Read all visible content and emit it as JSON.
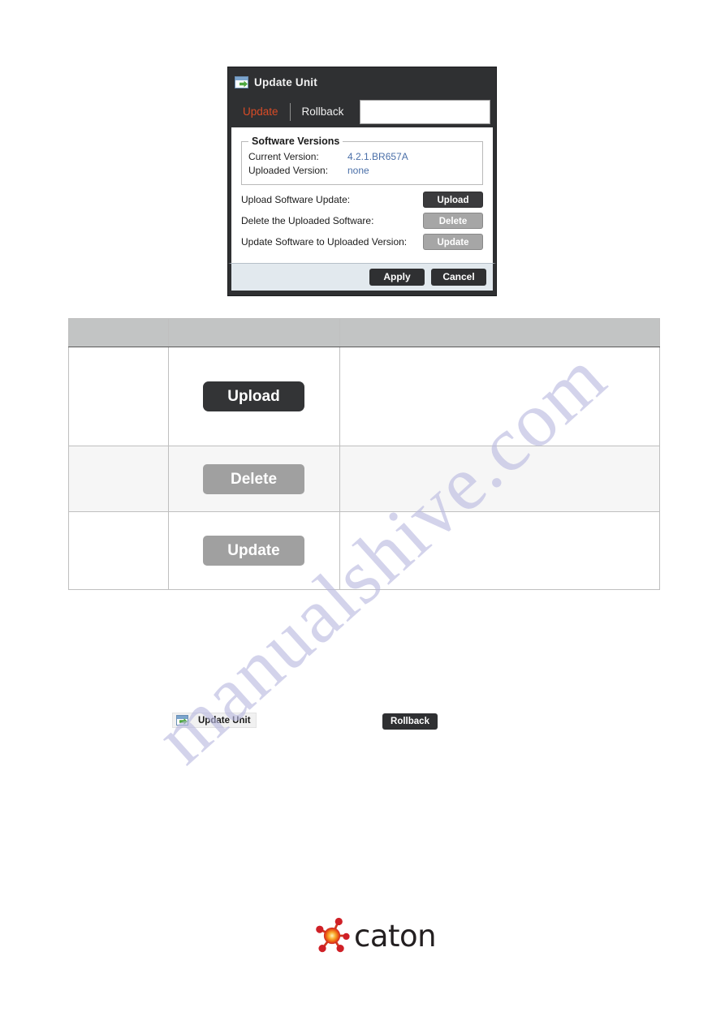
{
  "dialog": {
    "title": "Update Unit",
    "title_icon": "window-image-icon",
    "tabs": [
      {
        "label": "Update",
        "active": true
      },
      {
        "label": "Rollback",
        "active": false
      }
    ],
    "tab_field_value": "",
    "fieldset": {
      "legend": "Software Versions",
      "rows": [
        {
          "label": "Current Version:",
          "value": "4.2.1.BR657A"
        },
        {
          "label": "Uploaded Version:",
          "value": "none"
        }
      ]
    },
    "actions": [
      {
        "label": "Upload Software Update:",
        "button": "Upload",
        "state": "enabled"
      },
      {
        "label": "Delete the Uploaded Software:",
        "button": "Delete",
        "state": "disabled"
      },
      {
        "label": "Update Software to Uploaded Version:",
        "button": "Update",
        "state": "disabled"
      }
    ],
    "footer": {
      "apply": "Apply",
      "cancel": "Cancel"
    }
  },
  "table": {
    "headers": [
      "",
      "",
      ""
    ],
    "rows": [
      {
        "col_a": "",
        "button": "Upload",
        "style": "dark",
        "col_c": ""
      },
      {
        "col_a": "",
        "button": "Delete",
        "style": "gray",
        "col_c": ""
      },
      {
        "col_a": "",
        "button": "Update",
        "style": "gray",
        "col_c": ""
      }
    ]
  },
  "inline_refs": {
    "update_unit_label": "Update Unit",
    "update_unit_icon": "window-arrow-icon",
    "rollback_label": "Rollback"
  },
  "logo": {
    "text": "caton",
    "mark": "molecule-star-icon"
  },
  "watermark": {
    "text": "manualshive.com"
  },
  "colors": {
    "dialog_chrome": "#2f3032",
    "tab_active": "#d94b26",
    "version_value": "#4a6fa8",
    "button_dark": "#3b3b3d",
    "button_gray": "#a6a6a6",
    "footer_bg": "#e2e9ee",
    "table_header": "#c2c4c4",
    "watermark": "#b9b9e0",
    "logo_red": "#cf2027",
    "logo_orange": "#f39200"
  }
}
